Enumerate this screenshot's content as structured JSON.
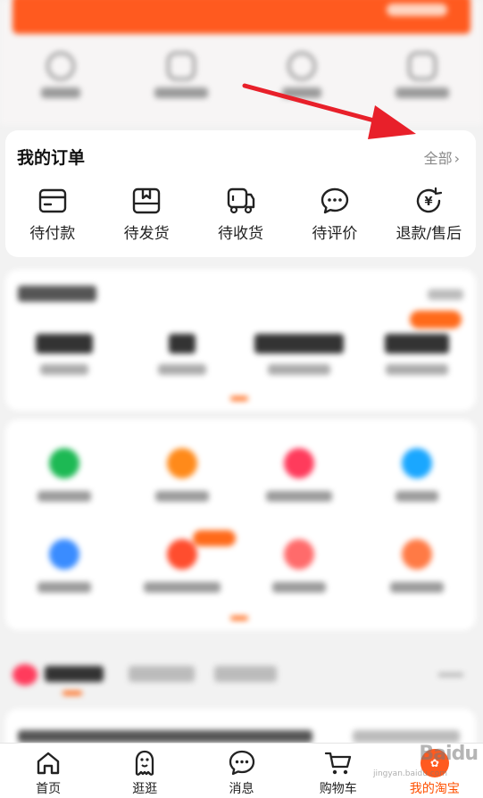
{
  "orders": {
    "title": "我的订单",
    "view_all": "全部",
    "items": [
      {
        "label": "待付款",
        "icon": "wallet-icon"
      },
      {
        "label": "待发货",
        "icon": "package-icon"
      },
      {
        "label": "待收货",
        "icon": "truck-icon"
      },
      {
        "label": "待评价",
        "icon": "comment-icon"
      },
      {
        "label": "退款/售后",
        "icon": "refund-icon"
      }
    ]
  },
  "tabbar": {
    "items": [
      {
        "label": "首页",
        "icon": "home-icon",
        "active": false
      },
      {
        "label": "逛逛",
        "icon": "browse-icon",
        "active": false
      },
      {
        "label": "消息",
        "icon": "message-icon",
        "active": false
      },
      {
        "label": "购物车",
        "icon": "cart-icon",
        "active": false
      },
      {
        "label": "我的淘宝",
        "icon": "avatar-icon",
        "active": true
      }
    ]
  },
  "watermark": {
    "text": "Baidu",
    "sub": "jingyan.baidu.com"
  },
  "colors": {
    "accent": "#ff5000",
    "annotation_arrow": "#e8202a",
    "banner": "#ff5a1f"
  }
}
